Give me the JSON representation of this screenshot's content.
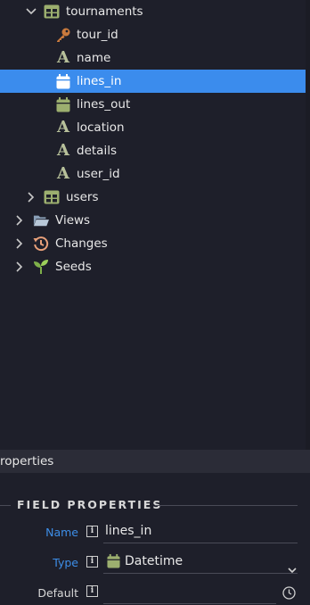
{
  "tree": {
    "table_name": "tournaments",
    "fields": [
      {
        "name": "tour_id",
        "icon": "key-icon",
        "selected": false
      },
      {
        "name": "name",
        "icon": "text-type-icon",
        "selected": false
      },
      {
        "name": "lines_in",
        "icon": "calendar-icon",
        "selected": true
      },
      {
        "name": "lines_out",
        "icon": "calendar-icon",
        "selected": false
      },
      {
        "name": "location",
        "icon": "text-type-icon",
        "selected": false
      },
      {
        "name": "details",
        "icon": "text-type-icon",
        "selected": false
      },
      {
        "name": "user_id",
        "icon": "text-type-icon",
        "selected": false
      }
    ],
    "users_label": "users",
    "views_label": "Views",
    "changes_label": "Changes",
    "seeds_label": "Seeds",
    "text_glyph": "A"
  },
  "properties": {
    "header": "roperties",
    "section_title": "FIELD PROPERTIES",
    "name_label": "Name",
    "name_value": "lines_in",
    "type_label": "Type",
    "type_value": "Datetime",
    "default_label": "Default",
    "default_value": "",
    "info_glyph": "i"
  },
  "colors": {
    "background": "#1e1f2a",
    "selection": "#3b8ced",
    "table_icon": "#9caf6f",
    "key_icon": "#c97a3d",
    "label_blue": "#3d8ee8"
  }
}
